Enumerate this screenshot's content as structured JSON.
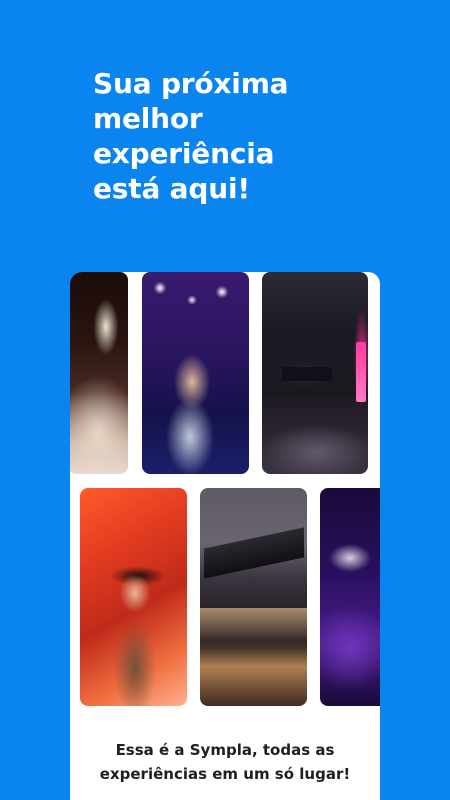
{
  "headline": {
    "lines": [
      "Sua próxima",
      "melhor",
      "experiência",
      "está aqui!"
    ]
  },
  "gallery": {
    "photos": [
      {
        "name": "concert-crowd-photo"
      },
      {
        "name": "singer-on-stage-photo"
      },
      {
        "name": "conference-audience-photo"
      },
      {
        "name": "performer-with-hat-photo"
      },
      {
        "name": "museum-at-night-photo"
      },
      {
        "name": "purple-stage-photo"
      }
    ]
  },
  "caption": {
    "lines": [
      "Essa é a Sympla, todas as",
      "experiências em um só lugar!"
    ]
  },
  "colors": {
    "background": "#0a85f0",
    "card": "#ffffff",
    "caption_text": "#1f1f1f"
  }
}
